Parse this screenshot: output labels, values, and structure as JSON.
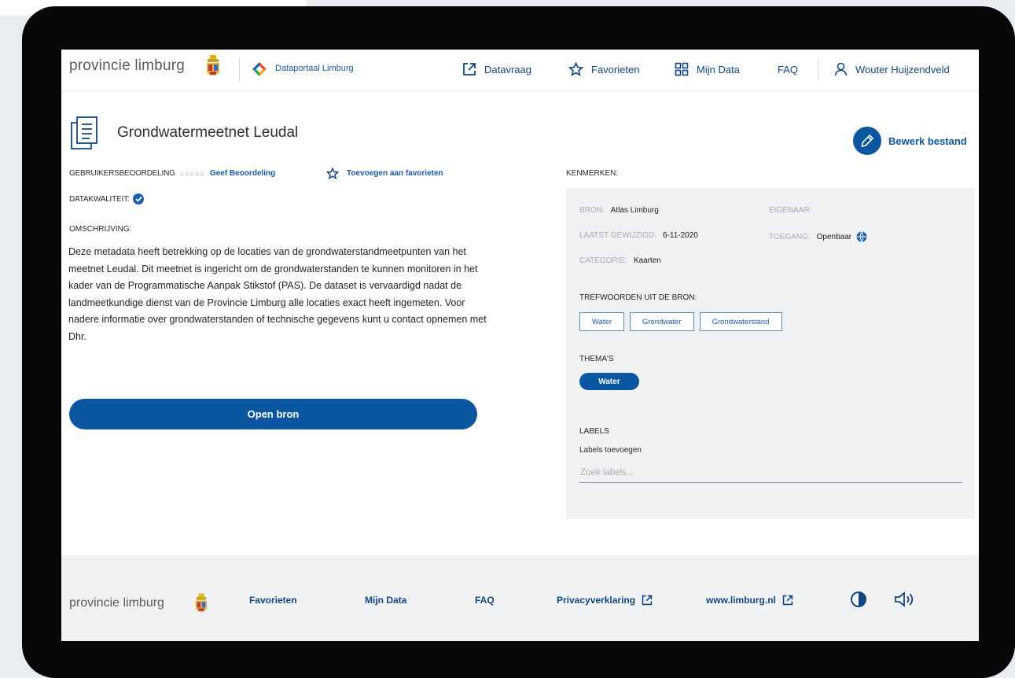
{
  "header": {
    "brand": "provincie limburg",
    "portal_name": "Dataportaal Limburg",
    "nav": {
      "datavraag": "Datavraag",
      "favorieten": "Favorieten",
      "mijn_data": "Mijn Data",
      "faq": "FAQ"
    },
    "user_name": "Wouter Huijzendveld"
  },
  "page": {
    "title": "Grondwatermeetnet Leudal",
    "edit_label": "Bewerk bestand",
    "rating_label": "GEBRUIKERSBEOORDELING",
    "rating_dots": "○○○○○",
    "rating_link": "Geef Beoordeling",
    "add_favorite": "Toevoegen aan favorieten",
    "quality_label": "DATAKWALITEIT:",
    "description_label": "OMSCHRIJVING:",
    "description": "Deze metadata heeft betrekking op de locaties van de grondwaterstandmeetpunten van het meetnet Leudal. Dit meetnet is ingericht om de grondwaterstanden te kunnen monitoren in het kader van de Programmatische Aanpak Stikstof (PAS). De dataset is vervaardigd nadat de landmeetkundige dienst van de Provincie Limburg alle locaties exact heeft ingemeten. Voor nadere informatie over grondwaterstanden of technische gegevens kunt u contact opnemen met Dhr.",
    "open_button": "Open bron"
  },
  "kenmerken": {
    "label": "KENMERKEN:",
    "bron_key": "BRON:",
    "bron_value": "Atlas Limburg",
    "eigenaar_key": "EIGENAAR:",
    "gewijzigd_key": "LAATST GEWIJZIGD:",
    "gewijzigd_value": "6-11-2020",
    "toegang_key": "TOEGANG:",
    "toegang_value": "Openbaar",
    "categorie_key": "CATEGORIE:",
    "categorie_value": "Kaarten",
    "trefwoorden_label": "TREFWOORDEN UIT DE BRON:",
    "trefwoorden": [
      "Water",
      "Grondwater",
      "Grondwaterstand"
    ],
    "themas_label": "THEMA'S",
    "thema": "Water",
    "labels_label": "LABELS",
    "labels_add": "Labels toevoegen",
    "labels_placeholder": "Zoek labels..."
  },
  "footer": {
    "brand": "provincie limburg",
    "favorieten": "Favorieten",
    "mijn_data": "Mijn Data",
    "faq": "FAQ",
    "privacy": "Privacyverklaring",
    "site": "www.limburg.nl"
  },
  "colors": {
    "primary": "#0b56a0",
    "link": "#1a5aa3",
    "panel": "#f0f1f3",
    "footer": "#f1f2f4",
    "device": "#070707"
  }
}
